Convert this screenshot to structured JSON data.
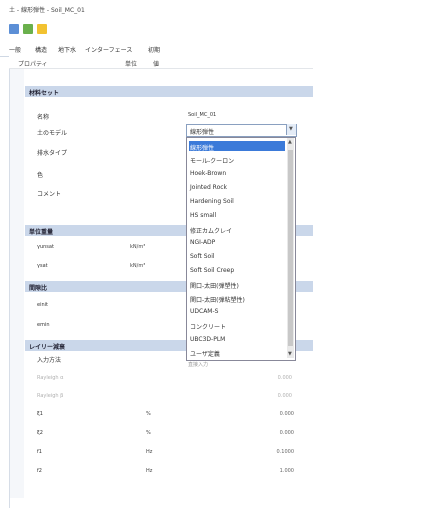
{
  "window": {
    "title": "土 - 線形弾性 - Soil_MC_01"
  },
  "toolbar": {
    "icons": [
      "grid-icon",
      "image-icon",
      "yellow-doc-icon"
    ]
  },
  "tabs": [
    "一般",
    "構造",
    "地下水",
    "インターフェース",
    "初期"
  ],
  "table_header": {
    "property": "プロパティ",
    "unit": "単位",
    "value": "値"
  },
  "sections": {
    "material_set": "材料セット",
    "unit_weight": "単位重量",
    "void_ratio": "間隙比",
    "rayleigh": "レイリー減衰"
  },
  "material_set": {
    "name_label": "名称",
    "name_value": "Soil_MC_01",
    "model_label": "土のモデル",
    "model_value": "線形弾性",
    "drain_label": "排水タイプ",
    "color_label": "色",
    "comment_label": "コメント"
  },
  "unit_weight": {
    "unsat_label": "γunsat",
    "unsat_unit": "kN/m³",
    "sat_label": "γsat",
    "sat_unit": "kN/m³"
  },
  "void_ratio": {
    "einit_label": "einit",
    "emin_label": "emin"
  },
  "rayleigh": {
    "input_method_label": "入力方法",
    "input_method_value": "直接入力",
    "alpha_label": "Rayleigh α",
    "alpha_value": "0.000",
    "beta_label": "Rayleigh β",
    "beta_value": "0.000",
    "xi1_label": "ξ1",
    "xi1_unit": "%",
    "xi1_value": "0.000",
    "xi2_label": "ξ2",
    "xi2_unit": "%",
    "xi2_value": "0.000",
    "f1_label": "f1",
    "f1_unit": "Hz",
    "f1_value": "0.1000",
    "f2_label": "f2",
    "f2_unit": "Hz",
    "f2_value": "1.000"
  },
  "dropdown": {
    "items": [
      "線形弾性",
      "モール-クーロン",
      "Hoek-Brown",
      "Jointed Rock",
      "Hardening Soil",
      "HS small",
      "修正カムクレイ",
      "NGI-ADP",
      "Soft Soil",
      "Soft Soil Creep",
      "関口-太田(弾塑性)",
      "関口-太田(弾粘塑性)",
      "UDCAM-S",
      "コンクリート",
      "UBC3D-PLM",
      "ユーザ定義"
    ],
    "selected": "線形弾性"
  }
}
